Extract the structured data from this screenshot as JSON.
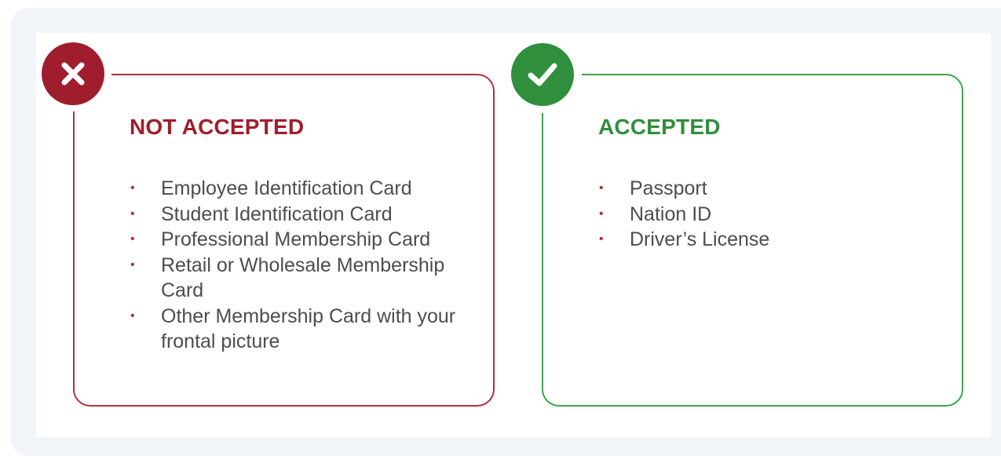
{
  "not_accepted": {
    "title": "NOT ACCEPTED",
    "icon": "x-icon",
    "color": "#9f1d2c",
    "items": [
      "Employee Identification Card",
      "Student Identification Card",
      "Professional Membership Card",
      "Retail or Wholesale Membership Card",
      "Other Membership Card with your frontal picture"
    ]
  },
  "accepted": {
    "title": "ACCEPTED",
    "icon": "check-icon",
    "color": "#2f8f3c",
    "items": [
      "Passport",
      "Nation ID",
      "Driver’s License"
    ]
  }
}
